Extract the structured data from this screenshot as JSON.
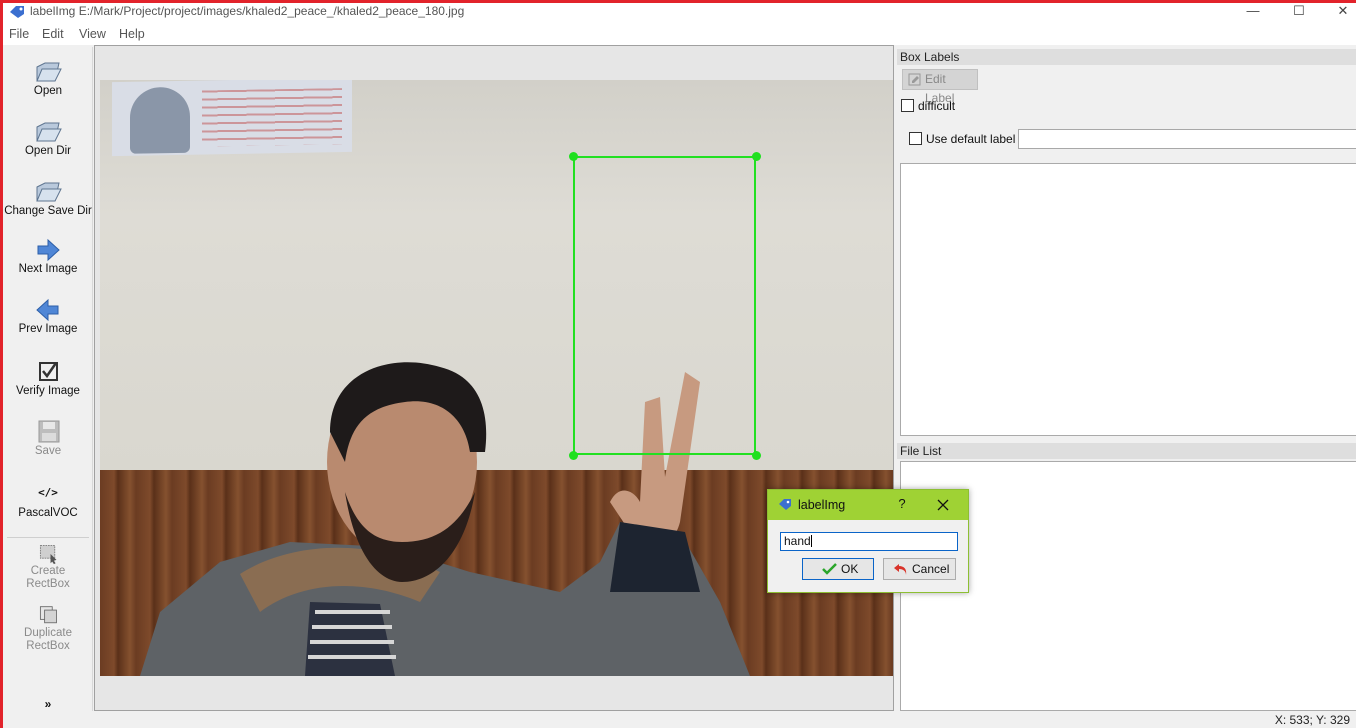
{
  "window": {
    "title": "labelImg E:/Mark/Project/project/images/khaled2_peace_/khaled2_peace_180.jpg",
    "minimize": "—",
    "maximize": "☐",
    "close": "✕"
  },
  "menu": {
    "items": [
      "File",
      "Edit",
      "View",
      "Help"
    ]
  },
  "toolbar": {
    "tools": [
      {
        "label": "Open"
      },
      {
        "label": "Open Dir"
      },
      {
        "label": "Change Save Dir"
      },
      {
        "label": "Next Image"
      },
      {
        "label": "Prev Image"
      },
      {
        "label": "Verify Image"
      },
      {
        "label": "Save"
      },
      {
        "label": "PascalVOC",
        "icon_text": "</>"
      },
      {
        "label": "Create\nRectBox",
        "line1": "Create",
        "line2": "RectBox"
      },
      {
        "label": "Duplicate\nRectBox",
        "line1": "Duplicate",
        "line2": "RectBox"
      }
    ],
    "more": "»"
  },
  "box_labels_panel": {
    "title": "Box Labels",
    "edit_label_button": "Edit Label",
    "difficult_label": "difficult",
    "difficult_checked": false,
    "use_default_label": "Use default label",
    "use_default_checked": false,
    "default_label_value": ""
  },
  "file_list_panel": {
    "title": "File List"
  },
  "status": {
    "coords": "X: 533; Y: 329"
  },
  "dialog": {
    "title": "labelImg",
    "help": "?",
    "input_value": "hand",
    "ok_label": "OK",
    "cancel_label": "Cancel"
  },
  "colors": {
    "bbox": "#22e022",
    "dialog_title": "#9fd234",
    "window_border": "#e2232b"
  }
}
